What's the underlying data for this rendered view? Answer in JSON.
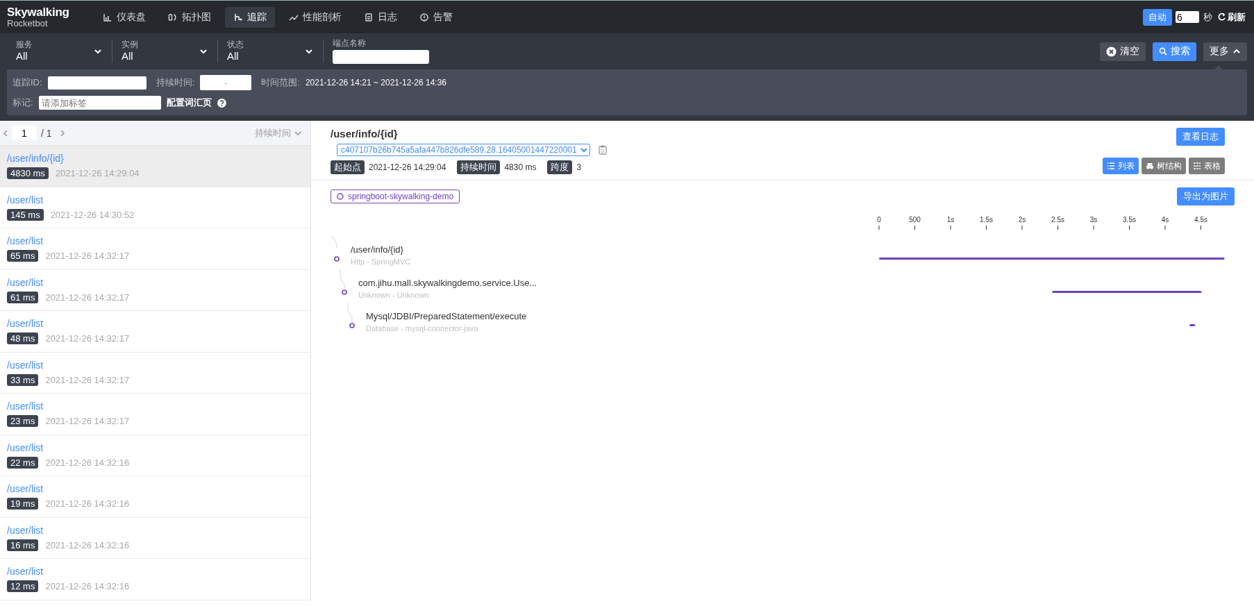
{
  "brand": {
    "title": "Skywalking",
    "subtitle": "Rocketbot"
  },
  "nav": [
    {
      "label": "仪表盘",
      "kind": "dashboard",
      "selected": false
    },
    {
      "label": "拓扑图",
      "kind": "topology",
      "selected": false
    },
    {
      "label": "追踪",
      "kind": "trace",
      "selected": true
    },
    {
      "label": "性能剖析",
      "kind": "profile",
      "selected": false
    },
    {
      "label": "日志",
      "kind": "log",
      "selected": false
    },
    {
      "label": "告警",
      "kind": "alarm",
      "selected": false
    }
  ],
  "auto_refresh": {
    "button": "自动",
    "on": true,
    "interval": "6",
    "unit": "秒",
    "refresh": "刷新"
  },
  "filters": [
    {
      "label": "服务",
      "value": "All"
    },
    {
      "label": "实例",
      "value": "All"
    },
    {
      "label": "状态",
      "value": "All"
    }
  ],
  "endpoint": {
    "label": "端点名称"
  },
  "actions": {
    "clear": "清空",
    "search": "搜索",
    "more": "更多",
    "expanded": true
  },
  "more_panel": {
    "trace_id_label": "追踪ID:",
    "duration_label": "持续时间:",
    "duration_separator": "-",
    "time_range_label": "时间范围:",
    "time_range": "2021-12-26 14:21 ~ 2021-12-26 14:36",
    "tags_label": "标记:",
    "tags_placeholder": "请添加标签",
    "tags_link": "配置词汇页"
  },
  "pagination": {
    "page": "1",
    "total": "/ 1",
    "sort": "持续时间"
  },
  "traces": [
    {
      "endpoint": "/user/info/{id}",
      "duration": "4830 ms",
      "time": "2021-12-26 14:29:04",
      "selected": true
    },
    {
      "endpoint": "/user/list",
      "duration": "145 ms",
      "time": "2021-12-26 14:30:52",
      "selected": false
    },
    {
      "endpoint": "/user/list",
      "duration": "65 ms",
      "time": "2021-12-26 14:32:17",
      "selected": false
    },
    {
      "endpoint": "/user/list",
      "duration": "61 ms",
      "time": "2021-12-26 14:32:17",
      "selected": false
    },
    {
      "endpoint": "/user/list",
      "duration": "48 ms",
      "time": "2021-12-26 14:32:17",
      "selected": false
    },
    {
      "endpoint": "/user/list",
      "duration": "33 ms",
      "time": "2021-12-26 14:32:17",
      "selected": false
    },
    {
      "endpoint": "/user/list",
      "duration": "23 ms",
      "time": "2021-12-26 14:32:17",
      "selected": false
    },
    {
      "endpoint": "/user/list",
      "duration": "22 ms",
      "time": "2021-12-26 14:32:16",
      "selected": false
    },
    {
      "endpoint": "/user/list",
      "duration": "19 ms",
      "time": "2021-12-26 14:32:16",
      "selected": false
    },
    {
      "endpoint": "/user/list",
      "duration": "16 ms",
      "time": "2021-12-26 14:32:16",
      "selected": false
    },
    {
      "endpoint": "/user/list",
      "duration": "12 ms",
      "time": "2021-12-26 14:32:16",
      "selected": false
    }
  ],
  "detail": {
    "title": "/user/info/{id}",
    "trace_id": "c407107b26b745a5afa447b826dfe589.28.16405001447220001",
    "start_label": "起始点",
    "start": "2021-12-26 14:29:04",
    "duration_label": "持续时间",
    "duration": "4830 ms",
    "spans_label": "跨度",
    "spans": "3",
    "view_log": "查看日志",
    "views": [
      {
        "label": "列表",
        "kind": "list",
        "selected": true
      },
      {
        "label": "树结构",
        "kind": "tree",
        "selected": false
      },
      {
        "label": "表格",
        "kind": "table",
        "selected": false
      }
    ],
    "service": "springboot-skywalking-demo",
    "export": "导出为图片"
  },
  "spans": [
    {
      "name": "/user/info/{id}",
      "meta": "Http - SpringMVC",
      "children": [
        {
          "name": "com.jihu.mall.skywalkingdemo.service.Use...",
          "meta": "Unknown - Unknown",
          "children": [
            {
              "name": "Mysql/JDBI/PreparedStatement/execute",
              "meta": "Database - mysql-connector-java"
            }
          ]
        }
      ]
    }
  ],
  "timeline": {
    "ticks": [
      "0",
      "500",
      "1s",
      "1.5s",
      "2s",
      "2.5s",
      "3s",
      "3.5s",
      "4s",
      "4.5s"
    ]
  }
}
